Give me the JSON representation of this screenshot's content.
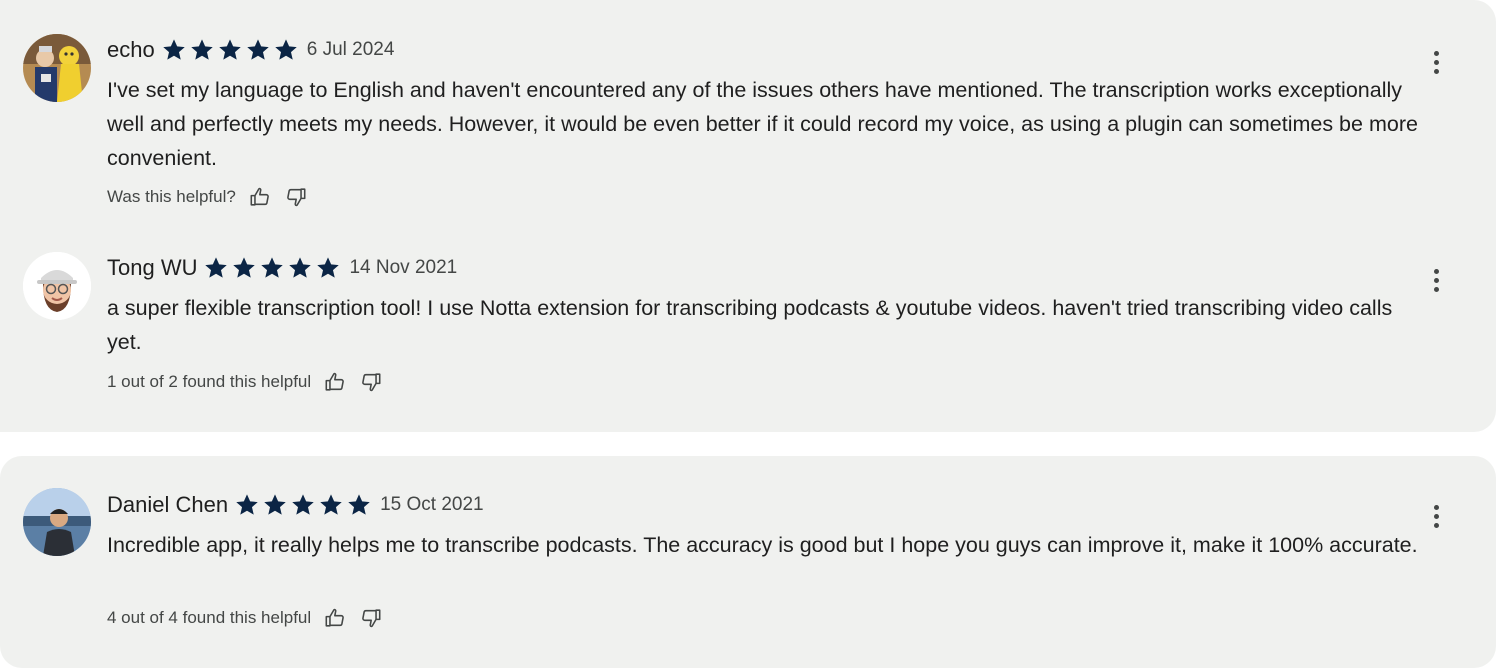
{
  "colors": {
    "card_background": "#f0f1ef",
    "star": "#0b2545",
    "text_primary": "#1f1f1f",
    "text_secondary": "#444746"
  },
  "reviews": [
    {
      "author": "echo",
      "rating": 5,
      "date": "6 Jul 2024",
      "text": "I've set my language to English and haven't encountered any of the issues others have mentioned. The transcription works exceptionally well and perfectly meets my needs. However, it would be even better if it could record my voice, as using a plugin can sometimes be more convenient.",
      "helpful_text": "Was this helpful?",
      "avatar_icon": "avatar-photo-two-kids-costumes"
    },
    {
      "author": "Tong WU",
      "rating": 5,
      "date": "14 Nov 2021",
      "text": "a super flexible transcription tool! I use Notta extension for transcribing podcasts & youtube videos. haven't tried transcribing video calls yet.",
      "helpful_text": "1 out of 2 found this helpful",
      "avatar_icon": "memoji-avatar-with-cap"
    },
    {
      "author": "Daniel Chen",
      "rating": 5,
      "date": "15 Oct 2021",
      "text": "Incredible app, it really helps me to transcribe podcasts. The accuracy is good but I hope you guys can improve it, make it 100% accurate.",
      "helpful_text": "4 out of 4 found this helpful",
      "avatar_icon": "avatar-photo-man-by-water"
    }
  ],
  "icons": {
    "star": "star-icon",
    "thumbs_up": "thumbs-up-icon",
    "thumbs_down": "thumbs-down-icon",
    "more": "more-vertical-icon"
  }
}
